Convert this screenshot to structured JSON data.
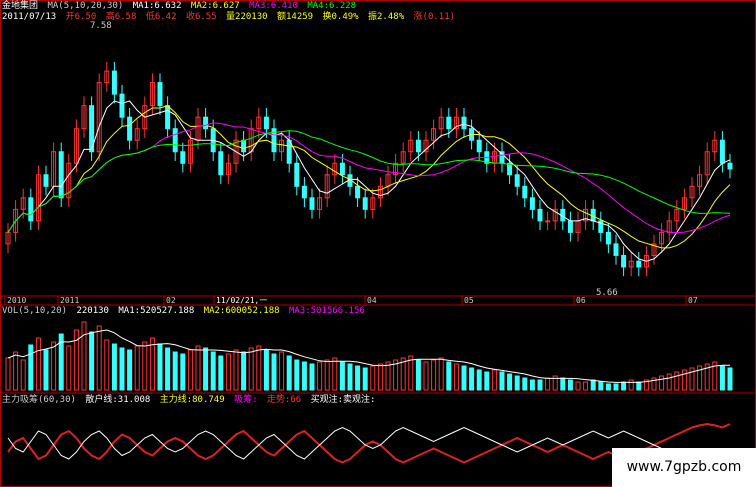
{
  "stock": {
    "name": "金地集团",
    "ma_label": "MA(5,10,20,30)",
    "ma1": "MA1:6.632",
    "ma2": "MA2:6.627",
    "ma3": "MA3:6.410",
    "ma4": "MA4:6.228"
  },
  "quote": {
    "date": "2011/07/13",
    "open": "开6.50",
    "high": "高6.58",
    "low": "低6.42",
    "close": "收6.55",
    "volume": "量220130",
    "amount": "额14259",
    "turnover": "换0.49%",
    "amplitude": "振2.48%",
    "change": "涨(0.11)"
  },
  "annotations": {
    "high": "7.58",
    "low": "5.66",
    "cursor_date": "11/02/21,一"
  },
  "volume_panel": {
    "label": "VOL(5,10,20)",
    "vol": "220130",
    "ma1": "MA1:520527.188",
    "ma2": "MA2:600052.188",
    "ma3": "MA3:501566.156"
  },
  "indicator_panel": {
    "label": "主力吸筹(60,30)",
    "retail": "散户线:31.008",
    "main": "主力线:80.749",
    "absorb": "吸筹:",
    "trend": "走势:66",
    "watch": "买观注:卖观注:"
  },
  "watermark": "www.7gpzb.com",
  "colors": {
    "up": "#ff3333",
    "down": "#33ffff",
    "ma1": "#ffffff",
    "ma2": "#ffff00",
    "ma3": "#ff00ff",
    "ma4": "#00ff00",
    "axis": "#b00000"
  },
  "chart_data": {
    "type": "candlestick",
    "x_ticks": [
      "2010",
      "2011",
      "02",
      "11/02/21,一",
      "04",
      "05",
      "06",
      "07"
    ],
    "price_range": [
      5.66,
      7.58
    ],
    "closes": [
      6.0,
      6.2,
      6.3,
      6.1,
      6.5,
      6.4,
      6.7,
      6.3,
      6.6,
      6.9,
      7.1,
      6.7,
      7.3,
      7.4,
      7.2,
      7.0,
      6.8,
      6.9,
      7.1,
      7.3,
      7.1,
      6.9,
      6.7,
      6.6,
      6.8,
      7.0,
      6.9,
      6.7,
      6.5,
      6.6,
      6.8,
      6.7,
      6.9,
      7.0,
      6.9,
      6.7,
      6.8,
      6.6,
      6.4,
      6.3,
      6.2,
      6.3,
      6.5,
      6.6,
      6.5,
      6.4,
      6.3,
      6.2,
      6.3,
      6.4,
      6.5,
      6.6,
      6.7,
      6.8,
      6.7,
      6.8,
      6.9,
      7.0,
      6.9,
      7.0,
      6.9,
      6.8,
      6.7,
      6.6,
      6.7,
      6.6,
      6.5,
      6.4,
      6.3,
      6.2,
      6.1,
      6.1,
      6.2,
      6.1,
      6.0,
      6.1,
      6.2,
      6.1,
      6.0,
      5.9,
      5.8,
      5.7,
      5.75,
      5.7,
      5.8,
      5.9,
      6.0,
      6.1,
      6.2,
      6.3,
      6.4,
      6.5,
      6.7,
      6.8,
      6.6,
      6.55
    ],
    "volume": [
      32,
      38,
      30,
      45,
      52,
      40,
      48,
      56,
      44,
      60,
      68,
      58,
      64,
      50,
      46,
      42,
      40,
      44,
      48,
      52,
      46,
      42,
      38,
      36,
      40,
      44,
      42,
      38,
      34,
      36,
      40,
      38,
      42,
      44,
      40,
      36,
      38,
      34,
      30,
      28,
      26,
      28,
      30,
      32,
      28,
      26,
      24,
      22,
      24,
      26,
      28,
      30,
      32,
      34,
      30,
      28,
      30,
      32,
      28,
      26,
      24,
      22,
      20,
      18,
      20,
      18,
      16,
      14,
      12,
      10,
      10,
      12,
      14,
      12,
      10,
      8,
      8,
      10,
      8,
      6,
      6,
      8,
      10,
      8,
      10,
      12,
      14,
      16,
      18,
      20,
      22,
      24,
      26,
      28,
      24,
      22
    ],
    "main_line": [
      40,
      55,
      60,
      45,
      30,
      35,
      50,
      65,
      70,
      60,
      45,
      35,
      30,
      40,
      55,
      65,
      60,
      50,
      40,
      35,
      45,
      55,
      60,
      55,
      45,
      35,
      30,
      35,
      45,
      55,
      65,
      70,
      60,
      50,
      40,
      35,
      45,
      55,
      65,
      70,
      60,
      50,
      40,
      30,
      25,
      30,
      40,
      50,
      55,
      50,
      40,
      30,
      25,
      30,
      35,
      40,
      45,
      40,
      35,
      30,
      25,
      30,
      35,
      40,
      45,
      50,
      55,
      60,
      55,
      50,
      45,
      40,
      45,
      50,
      45,
      40,
      35,
      30,
      35,
      40,
      35,
      30,
      35,
      40,
      45,
      50,
      55,
      60,
      65,
      70,
      75,
      78,
      80,
      78,
      75,
      80
    ],
    "retail_line": [
      60,
      45,
      40,
      55,
      70,
      65,
      50,
      35,
      30,
      40,
      55,
      65,
      70,
      60,
      45,
      35,
      40,
      50,
      60,
      65,
      55,
      45,
      40,
      45,
      55,
      65,
      70,
      65,
      55,
      45,
      35,
      30,
      40,
      50,
      60,
      65,
      55,
      45,
      35,
      30,
      40,
      50,
      60,
      70,
      75,
      70,
      60,
      50,
      45,
      50,
      60,
      70,
      75,
      70,
      65,
      60,
      55,
      60,
      65,
      70,
      75,
      70,
      65,
      60,
      55,
      50,
      45,
      40,
      45,
      50,
      55,
      60,
      55,
      50,
      55,
      60,
      65,
      70,
      65,
      60,
      65,
      70,
      65,
      60,
      55,
      50,
      45,
      40,
      35,
      30,
      25,
      22,
      20,
      22,
      25,
      31
    ]
  }
}
